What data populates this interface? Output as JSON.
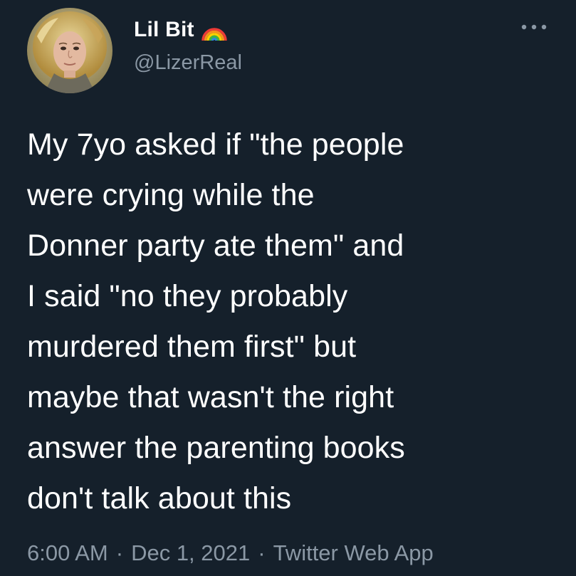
{
  "author": {
    "display_name": "Lil Bit",
    "handle": "@LizerReal",
    "badge_icon": "rainbow-icon",
    "avatar_icon": "profile-avatar"
  },
  "menu": {
    "icon": "more-options-icon"
  },
  "tweet": {
    "text": "My 7yo asked if \"the people\nwere crying while the\nDonner party ate them\" and\nI said \"no they probably\nmurdered them first\" but\nmaybe that wasn't the right\nanswer the parenting books\ndon't talk about this"
  },
  "meta": {
    "time": "6:00 AM",
    "separator": "·",
    "date": "Dec 1, 2021",
    "source": "Twitter Web App"
  },
  "colors": {
    "background": "#15202b",
    "primary_text": "#ffffff",
    "secondary_text": "#8b98a5"
  }
}
